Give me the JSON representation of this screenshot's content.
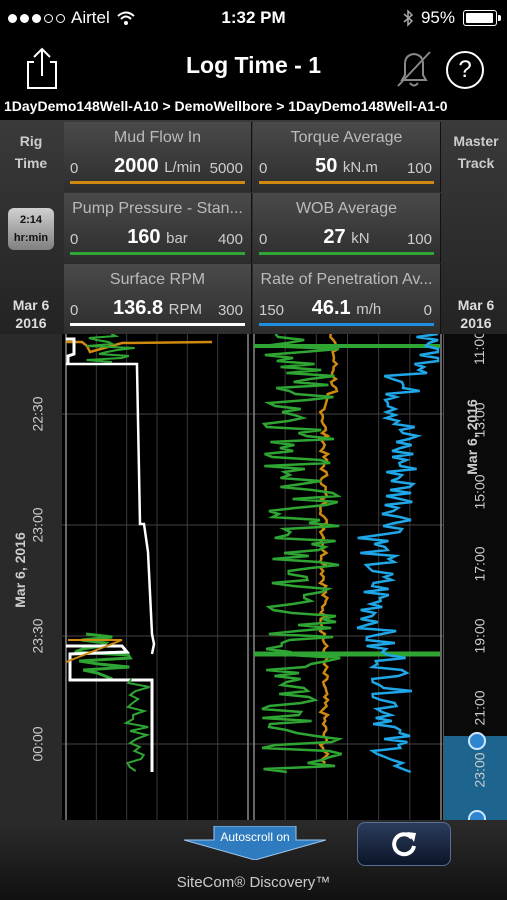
{
  "status": {
    "carrier": "Airtel",
    "time": "1:32 PM",
    "battery": "95%",
    "battery_level": 0.95
  },
  "nav": {
    "title": "Log Time - 1",
    "help": "?"
  },
  "breadcrumb": "1DayDemo148Well-A10 > DemoWellbore > 1DayDemo148Well-A1-0",
  "left_col": {
    "label1": "Rig",
    "label2": "Time",
    "zoom_value": "2:14",
    "zoom_unit": "hr:min",
    "date1": "Mar 6",
    "date2": "2016"
  },
  "right_col": {
    "label1": "Master",
    "label2": "Track",
    "date1": "Mar 6",
    "date2": "2016"
  },
  "tiles": [
    {
      "name": "Mud Flow In",
      "min": "0",
      "value": "2000",
      "unit": "L/min",
      "max": "5000",
      "color": "#d08a10"
    },
    {
      "name": "Torque Average",
      "min": "0",
      "value": "50",
      "unit": "kN.m",
      "max": "100",
      "color": "#d08a10"
    },
    {
      "name": "Pump Pressure - Stan...",
      "min": "0",
      "value": "160",
      "unit": "bar",
      "max": "400",
      "color": "#2fa533"
    },
    {
      "name": "WOB Average",
      "min": "0",
      "value": "27",
      "unit": "kN",
      "max": "100",
      "color": "#2fa533"
    },
    {
      "name": "Surface RPM",
      "min": "0",
      "value": "136.8",
      "unit": "RPM",
      "max": "300",
      "color": "#ffffff"
    },
    {
      "name": "Rate of Penetration Av...",
      "min": "150",
      "value": "46.1",
      "unit": "m/h",
      "max": "0",
      "color": "#1e8fe0"
    }
  ],
  "left_axis": {
    "title": "Mar 6, 2016",
    "ticks": [
      "22:30",
      "23:00",
      "23:30",
      "00:00"
    ]
  },
  "right_axis": {
    "title": "Mar 6, 2016",
    "ticks": [
      "11:00",
      "13:00",
      "15:00",
      "17:00",
      "19:00",
      "21:00",
      "23:00"
    ]
  },
  "colors": {
    "orange": "#d08a10",
    "green": "#2fa533",
    "white": "#ffffff",
    "blue": "#1fa7e8"
  },
  "bottom": {
    "autoscroll": "Autoscroll on",
    "footer": "SiteCom® Discovery™"
  }
}
